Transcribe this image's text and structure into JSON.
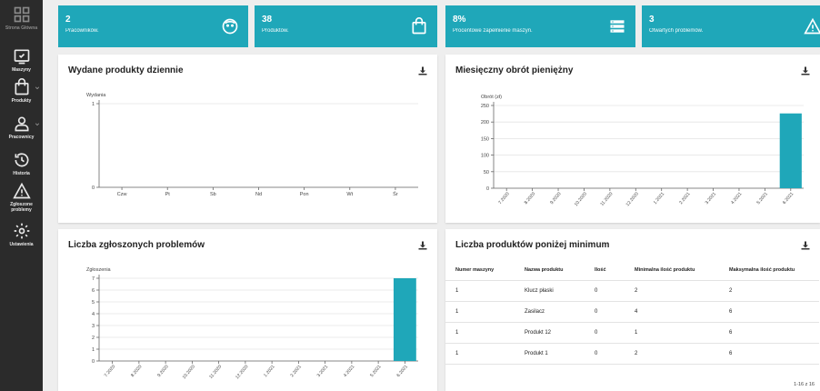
{
  "sidebar": {
    "items": [
      {
        "label": "Strona Główna",
        "icon": "dashboard-icon",
        "active": true
      },
      {
        "label": "Maszyny",
        "icon": "machine-icon",
        "active": false
      },
      {
        "label": "Produkty",
        "icon": "bag-icon",
        "active": false,
        "expandable": true
      },
      {
        "label": "Pracownicy",
        "icon": "person-icon",
        "active": false,
        "expandable": true
      },
      {
        "label": "Historia",
        "icon": "history-icon",
        "active": false
      },
      {
        "label": "Zgłoszone problemy",
        "icon": "warning-icon",
        "active": false
      },
      {
        "label": "Ustawienia",
        "icon": "gear-icon",
        "active": false
      }
    ]
  },
  "stats": [
    {
      "value": "2",
      "label": "Pracowników.",
      "icon": "face-icon"
    },
    {
      "value": "38",
      "label": "Produktów.",
      "icon": "bag-icon"
    },
    {
      "value": "8%",
      "label": "Procentowe zapełnienie maszyn.",
      "icon": "storage-icon"
    },
    {
      "value": "3",
      "label": "Otwartych problemów.",
      "icon": "warning-icon"
    }
  ],
  "colors": {
    "accent": "#1fa7b9",
    "sidebar": "#2b2b2b",
    "background": "#eeeeee"
  },
  "panels": {
    "daily": {
      "title": "Wydane produkty dziennie"
    },
    "monthly": {
      "title": "Miesięczny obrót pieniężny"
    },
    "problems": {
      "title": "Liczba zgłoszonych problemów"
    },
    "below_min": {
      "title": "Liczba produktów poniżej minimum"
    }
  },
  "chart_data": [
    {
      "type": "bar",
      "ylabel": "Wydania",
      "categories": [
        "Czw",
        "Pt",
        "Sb",
        "Nd",
        "Pon",
        "Wt",
        "Śr"
      ],
      "values": [
        0,
        0,
        0,
        0,
        0,
        0,
        0
      ],
      "yticks": [
        "0",
        "1"
      ],
      "ylim": [
        0,
        1
      ]
    },
    {
      "type": "bar",
      "ylabel": "Obrót (zł)",
      "categories": [
        "7.2020",
        "8.2020",
        "9.2020",
        "10.2020",
        "11.2020",
        "12.2020",
        "1.2021",
        "2.2021",
        "3.2021",
        "4.2021",
        "5.2021",
        "6.2021"
      ],
      "values": [
        0,
        0,
        0,
        0,
        0,
        0,
        0,
        0,
        0,
        0,
        0,
        226
      ],
      "yticks": [
        "0",
        "50",
        "100",
        "150",
        "200",
        "250"
      ],
      "ylim": [
        0,
        250
      ]
    },
    {
      "type": "bar",
      "ylabel": "Zgłoszenia",
      "categories": [
        "7.2020",
        "8.2020",
        "9.2020",
        "10.2020",
        "11.2020",
        "12.2020",
        "1.2021",
        "2.2021",
        "3.2021",
        "4.2021",
        "5.2021",
        "6.2021"
      ],
      "values": [
        0,
        0,
        0,
        0,
        0,
        0,
        0,
        0,
        0,
        0,
        0,
        7
      ],
      "yticks": [
        "0",
        "1",
        "2",
        "3",
        "4",
        "5",
        "6",
        "7"
      ],
      "ylim": [
        0,
        7
      ]
    }
  ],
  "table": {
    "headers": [
      "Numer maszyny",
      "Nazwa produktu",
      "Ilość",
      "Minimalna ilość produktu",
      "Maksymalna ilość produktu"
    ],
    "rows": [
      [
        "1",
        "Klucz płaski",
        "0",
        "2",
        "2"
      ],
      [
        "1",
        "Zasilacz",
        "0",
        "4",
        "6"
      ],
      [
        "1",
        "Produkt 12",
        "0",
        "1",
        "6"
      ],
      [
        "1",
        "Produkt 1",
        "0",
        "2",
        "6"
      ]
    ],
    "pagination": "1-16 z 16"
  }
}
